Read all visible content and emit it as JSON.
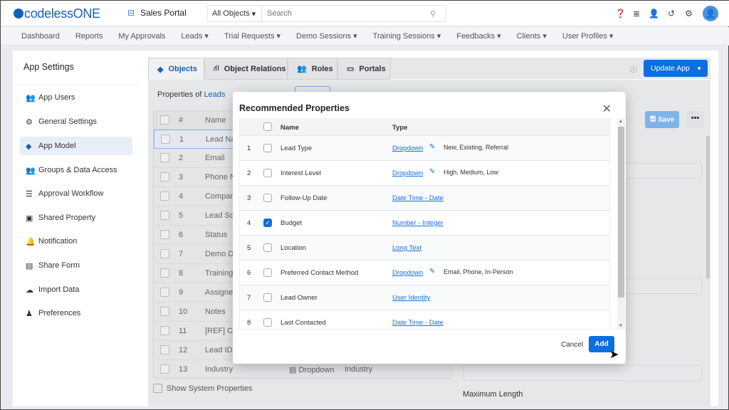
{
  "header": {
    "logo": "codelessONE",
    "app_name": "Sales Portal",
    "search_scope": "All Objects",
    "search_placeholder": "Search"
  },
  "nav": [
    "Dashboard",
    "Reports",
    "My Approvals",
    "Leads ▾",
    "Trial Requests ▾",
    "Demo Sessions ▾",
    "Training Sessions ▾",
    "Feedbacks ▾",
    "Clients ▾",
    "User Profiles ▾"
  ],
  "sidebar": {
    "title": "App Settings",
    "items": [
      {
        "label": "App Users",
        "icon": "users-icon"
      },
      {
        "label": "General Settings",
        "icon": "gear-icon"
      },
      {
        "label": "App Model",
        "icon": "cube-icon",
        "active": true
      },
      {
        "label": "Groups & Data Access",
        "icon": "group-icon"
      },
      {
        "label": "Approval Workflow",
        "icon": "workflow-icon"
      },
      {
        "label": "Shared Property",
        "icon": "shared-icon"
      },
      {
        "label": "Notification",
        "icon": "bell-icon"
      },
      {
        "label": "Share Form",
        "icon": "form-icon"
      },
      {
        "label": "Import Data",
        "icon": "cloud-upload-icon"
      },
      {
        "label": "Preferences",
        "icon": "preferences-icon"
      }
    ]
  },
  "tabs": [
    "Objects",
    "Object Relations",
    "Roles",
    "Portals"
  ],
  "update_app": "Update App",
  "properties_of": "Properties of",
  "object_name": "Leads",
  "bg_table": {
    "headers": [
      "#",
      "Name"
    ],
    "rows": [
      [
        "1",
        "Lead Na"
      ],
      [
        "2",
        "Email"
      ],
      [
        "3",
        "Phone N"
      ],
      [
        "4",
        "Compan"
      ],
      [
        "5",
        "Lead So"
      ],
      [
        "6",
        "Status"
      ],
      [
        "7",
        "Demo D"
      ],
      [
        "8",
        "Training"
      ],
      [
        "9",
        "Assigne"
      ],
      [
        "10",
        "Notes"
      ],
      [
        "11",
        "[REF] Cli"
      ],
      [
        "12",
        "Lead ID"
      ],
      [
        "13",
        "Industry",
        "Dropdown",
        "Industry"
      ]
    ]
  },
  "show_system": "Show System Properties",
  "save": "Save",
  "more": "•••",
  "max_length": "Maximum Length",
  "modal": {
    "title": "Recommended Properties",
    "headers": {
      "name": "Name",
      "type": "Type"
    },
    "rows": [
      {
        "n": "1",
        "name": "Lead Type",
        "type": "Dropdown",
        "options": "New, Existing, Referral",
        "checked": false
      },
      {
        "n": "2",
        "name": "Interest Level",
        "type": "Dropdown",
        "options": "High, Medium, Low",
        "checked": false
      },
      {
        "n": "3",
        "name": "Follow-Up Date",
        "type": "Date Time - Date",
        "options": "",
        "checked": false
      },
      {
        "n": "4",
        "name": "Budget",
        "type": "Number - Integer",
        "options": "",
        "checked": true
      },
      {
        "n": "5",
        "name": "Location",
        "type": "Long Text",
        "options": "",
        "checked": false
      },
      {
        "n": "6",
        "name": "Preferred Contact Method",
        "type": "Dropdown",
        "options": "Email, Phone, In-Person",
        "checked": false
      },
      {
        "n": "7",
        "name": "Lead Owner",
        "type": "User Identity",
        "options": "",
        "checked": false
      },
      {
        "n": "8",
        "name": "Last Contacted",
        "type": "Date Time - Date",
        "options": "",
        "checked": false
      }
    ],
    "cancel": "Cancel",
    "add": "Add"
  }
}
